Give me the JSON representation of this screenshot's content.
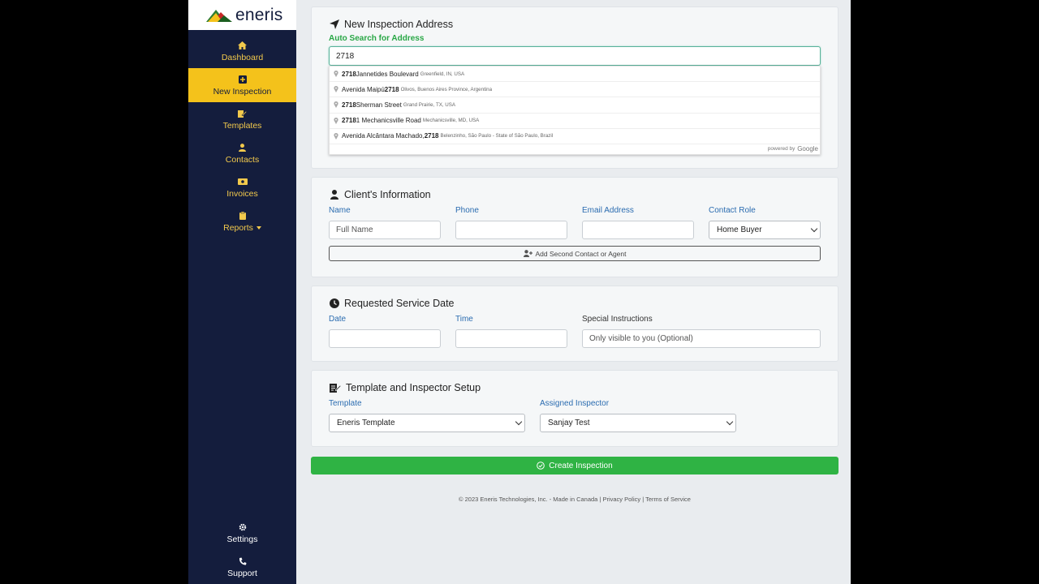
{
  "sidebar": {
    "brand": "eneris",
    "items": [
      {
        "label": "Dashboard",
        "icon": "home-icon"
      },
      {
        "label": "New Inspection",
        "icon": "plus-square-icon"
      },
      {
        "label": "Templates",
        "icon": "edit-doc-icon"
      },
      {
        "label": "Contacts",
        "icon": "user-icon"
      },
      {
        "label": "Invoices",
        "icon": "money-bill-icon"
      },
      {
        "label": "Reports",
        "icon": "clipboard-icon"
      }
    ],
    "bottom": [
      {
        "label": "Settings",
        "icon": "gear-icon"
      },
      {
        "label": "Support",
        "icon": "phone-icon"
      }
    ],
    "accent": "#f4c21b",
    "background": "#141d3d"
  },
  "address": {
    "title": "New Inspection Address",
    "auto_label": "Auto Search for Address",
    "value": "2718",
    "suggestions": [
      {
        "bold1": "2718",
        "main": " Jannetides Boulevard",
        "secondary": "Greenfield, IN, USA"
      },
      {
        "pre": "Avenida Maipú ",
        "bold1": "2718",
        "main": "",
        "secondary": "Olivos, Buenos Aires Province, Argentina"
      },
      {
        "bold1": "2718",
        "main": " Sherman Street",
        "secondary": "Grand Prairie, TX, USA"
      },
      {
        "bold1": "2718",
        "main": "1 Mechanicsville Road",
        "secondary": "Mechanicsville, MD, USA"
      },
      {
        "pre": "Avenida Alcântara Machado, ",
        "bold1": "2718",
        "main": "",
        "secondary": "Belenzinho, São Paulo - State of São Paulo, Brazil"
      }
    ],
    "powered_by": "powered by",
    "google": "Google"
  },
  "client": {
    "title": "Client's Information",
    "name_label": "Name",
    "name_placeholder": "Full Name",
    "phone_label": "Phone",
    "email_label": "Email Address",
    "role_label": "Contact Role",
    "role_value": "Home Buyer",
    "add_contact": "Add Second Contact or Agent"
  },
  "service": {
    "title": "Requested Service Date",
    "date_label": "Date",
    "time_label": "Time",
    "instructions_label": "Special Instructions",
    "instructions_placeholder": "Only visible to you (Optional)"
  },
  "template": {
    "title": "Template and Inspector Setup",
    "template_label": "Template",
    "template_value": "Eneris Template",
    "inspector_label": "Assigned Inspector",
    "inspector_value": "Sanjay Test"
  },
  "create_button": "Create Inspection",
  "footer": "© 2023 Eneris Technologies, Inc. - Made in Canada | Privacy Policy | Terms of Service"
}
